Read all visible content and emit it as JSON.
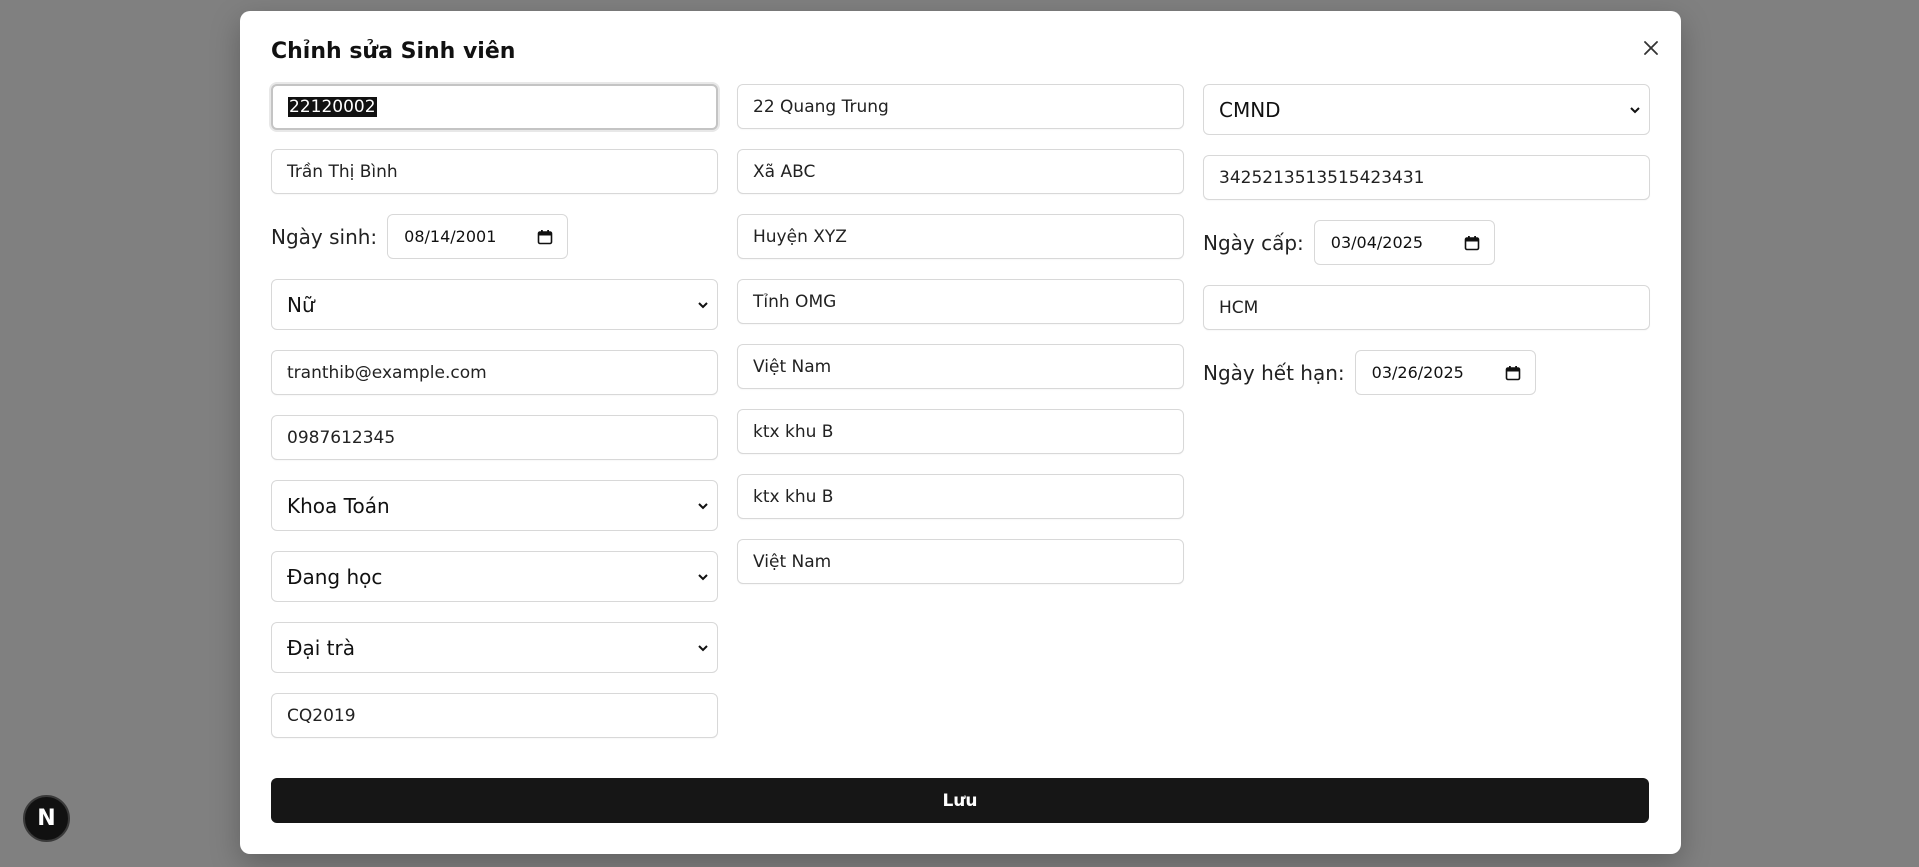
{
  "dialog": {
    "title": "Chỉnh sửa Sinh viên",
    "save_label": "Lưu"
  },
  "col1": {
    "student_id": "22120002",
    "full_name": "Trần Thị Bình",
    "dob_label": "Ngày sinh:",
    "dob_value": "08/14/2001",
    "gender": "Nữ",
    "email": "tranthib@example.com",
    "phone": "0987612345",
    "faculty": "Khoa Toán",
    "status": "Đang học",
    "program": "Đại trà",
    "course": "CQ2019"
  },
  "col2": {
    "street": "22 Quang Trung",
    "ward": "Xã ABC",
    "district": "Huyện XYZ",
    "province": "Tỉnh OMG",
    "country": "Việt Nam",
    "temp_address": "ktx khu B",
    "mailing_address": "ktx khu B",
    "nationality": "Việt Nam"
  },
  "col3": {
    "id_type": "CMND",
    "id_number": "3425213513515423431",
    "issue_date_label": "Ngày cấp:",
    "issue_date_value": "03/04/2025",
    "issue_place": "HCM",
    "expiry_date_label": "Ngày hết hạn:",
    "expiry_date_value": "03/26/2025"
  },
  "badge": {
    "letter": "N"
  }
}
